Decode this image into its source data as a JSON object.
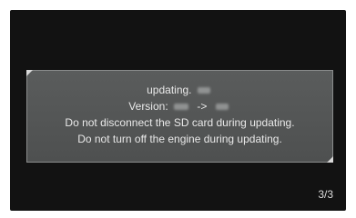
{
  "dialog": {
    "status_label": "updating.",
    "version_label": "Version:",
    "version_arrow": "->",
    "warning_sd": "Do not disconnect the SD card during updating.",
    "warning_engine": "Do not turn off the engine during updating."
  },
  "page_indicator": "3/3",
  "colors": {
    "screen_background": "#121212",
    "dialog_background": "#565858",
    "dialog_border": "#8a8c8c",
    "text": "#e9e9e9"
  }
}
